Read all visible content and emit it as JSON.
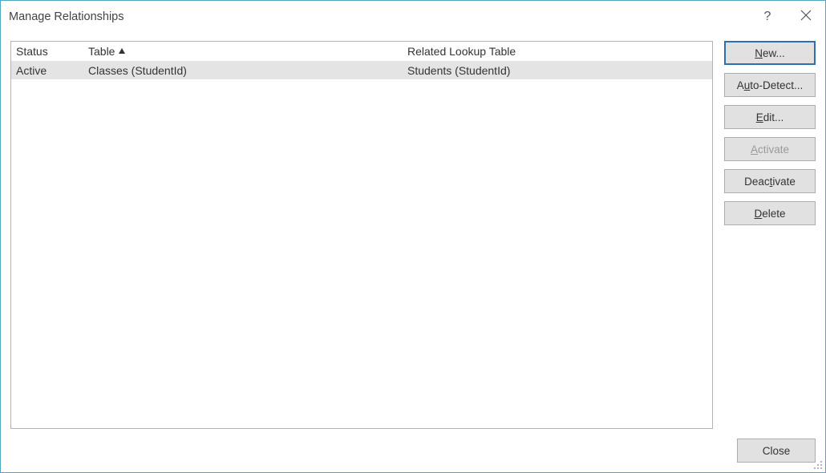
{
  "dialog": {
    "title": "Manage Relationships"
  },
  "columns": {
    "status": "Status",
    "table": "Table",
    "related": "Related Lookup Table",
    "sorted_by": "table",
    "sort_direction": "asc"
  },
  "rows": [
    {
      "status": "Active",
      "table": "Classes (StudentId)",
      "related": "Students (StudentId)",
      "selected": true
    }
  ],
  "buttons": {
    "new": "New...",
    "auto_detect": "Auto-Detect...",
    "edit": "Edit...",
    "activate": "Activate",
    "deactivate": "Deactivate",
    "delete": "Delete",
    "close": "Close",
    "activate_enabled": false
  }
}
